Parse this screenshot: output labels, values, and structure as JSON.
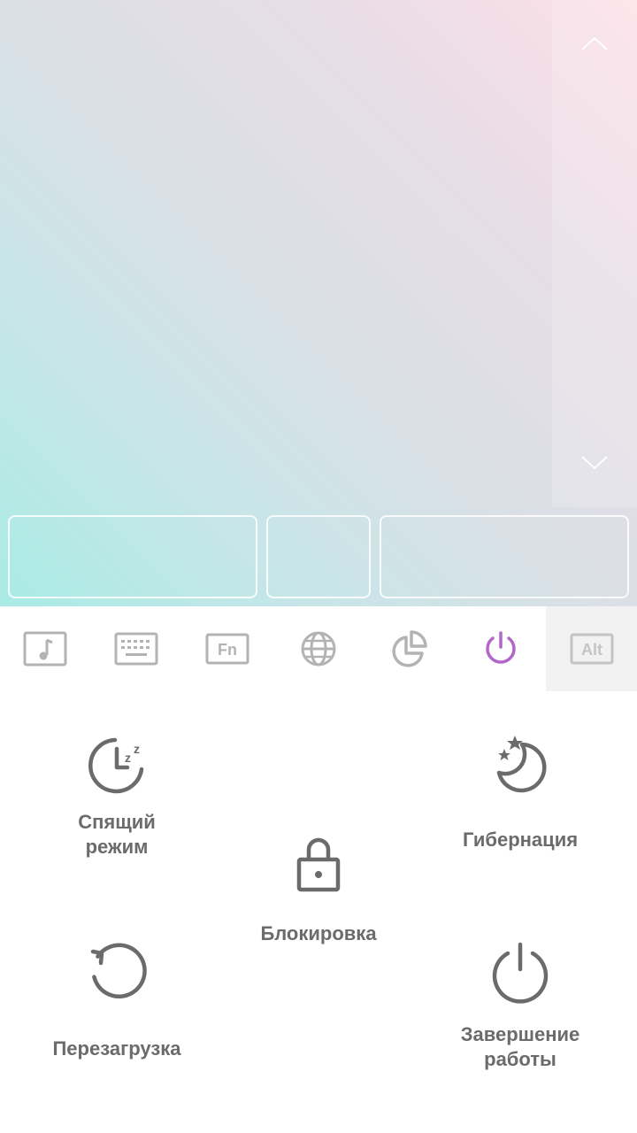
{
  "touchpad": {
    "scroll_up_icon": "chevron-up-icon",
    "scroll_down_icon": "chevron-down-icon"
  },
  "toolbar": {
    "items": [
      {
        "name": "media",
        "icon": "music-note-icon",
        "active": false
      },
      {
        "name": "keyboard",
        "icon": "keyboard-icon",
        "active": false
      },
      {
        "name": "function-keys",
        "icon": "fn-key-icon",
        "label": "Fn",
        "active": false
      },
      {
        "name": "browser",
        "icon": "globe-icon",
        "active": false
      },
      {
        "name": "presentation",
        "icon": "pie-chart-icon",
        "active": false
      },
      {
        "name": "power",
        "icon": "power-icon",
        "active": true
      },
      {
        "name": "alt-key",
        "icon": "alt-key-icon",
        "label": "Alt",
        "active": false
      }
    ],
    "active_color": "#b267c8",
    "inactive_color": "#b3b3b3"
  },
  "power": {
    "sleep_label": "Спящий\nрежим",
    "hibernate_label": "Гибернация",
    "lock_label": "Блокировка",
    "reboot_label": "Перезагрузка",
    "shutdown_label": "Завершение\nработы",
    "icon_color": "#6b6b6b"
  }
}
